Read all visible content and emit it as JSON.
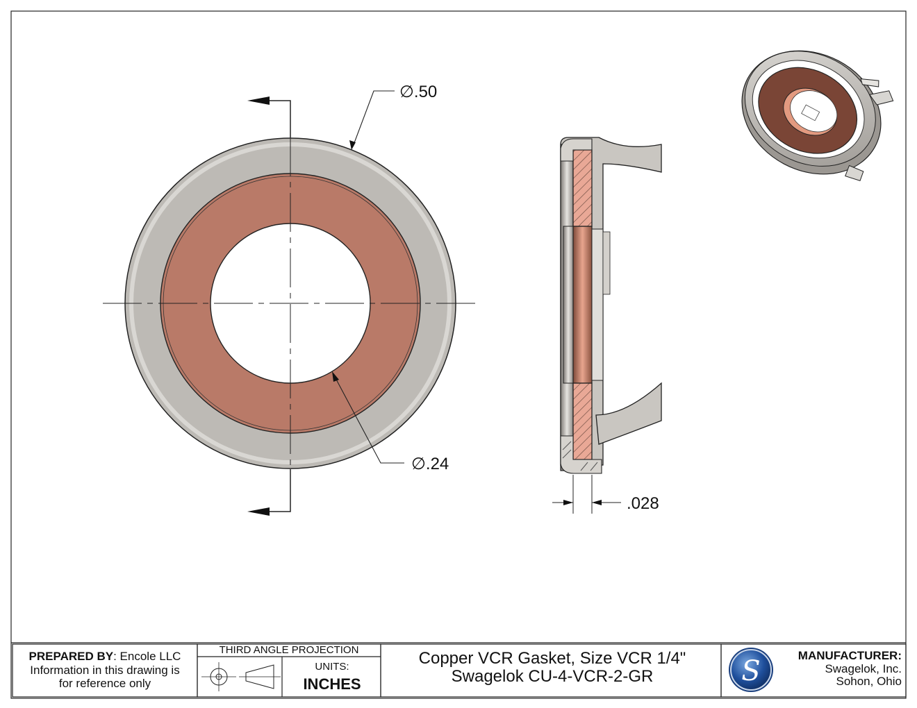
{
  "drawing": {
    "dimensions": {
      "outer_diameter": ".50",
      "inner_diameter": ".24",
      "thickness": ".028"
    },
    "diameter_symbol": "∅"
  },
  "title_block": {
    "prepared_by_label": "PREPARED BY",
    "prepared_by_value": ": Encole LLC",
    "disclaimer_line1": "Information in this drawing is",
    "disclaimer_line2": "for reference only",
    "projection_title": "THIRD ANGLE PROJECTION",
    "units_label": "UNITS:",
    "units_value": "INCHES",
    "title_line1": "Copper VCR Gasket, Size VCR 1/4\"",
    "title_line2": "Swagelok CU-4-VCR-2-GR",
    "manufacturer_label": "MANUFACTURER:",
    "manufacturer_name": "Swagelok, Inc.",
    "manufacturer_location": "Sohon, Ohio",
    "logo_letter": "S"
  },
  "colors": {
    "copper": "#b97a68",
    "steel": "#c4c1bc",
    "steel_dark": "#8f8b86",
    "line": "#111111"
  }
}
